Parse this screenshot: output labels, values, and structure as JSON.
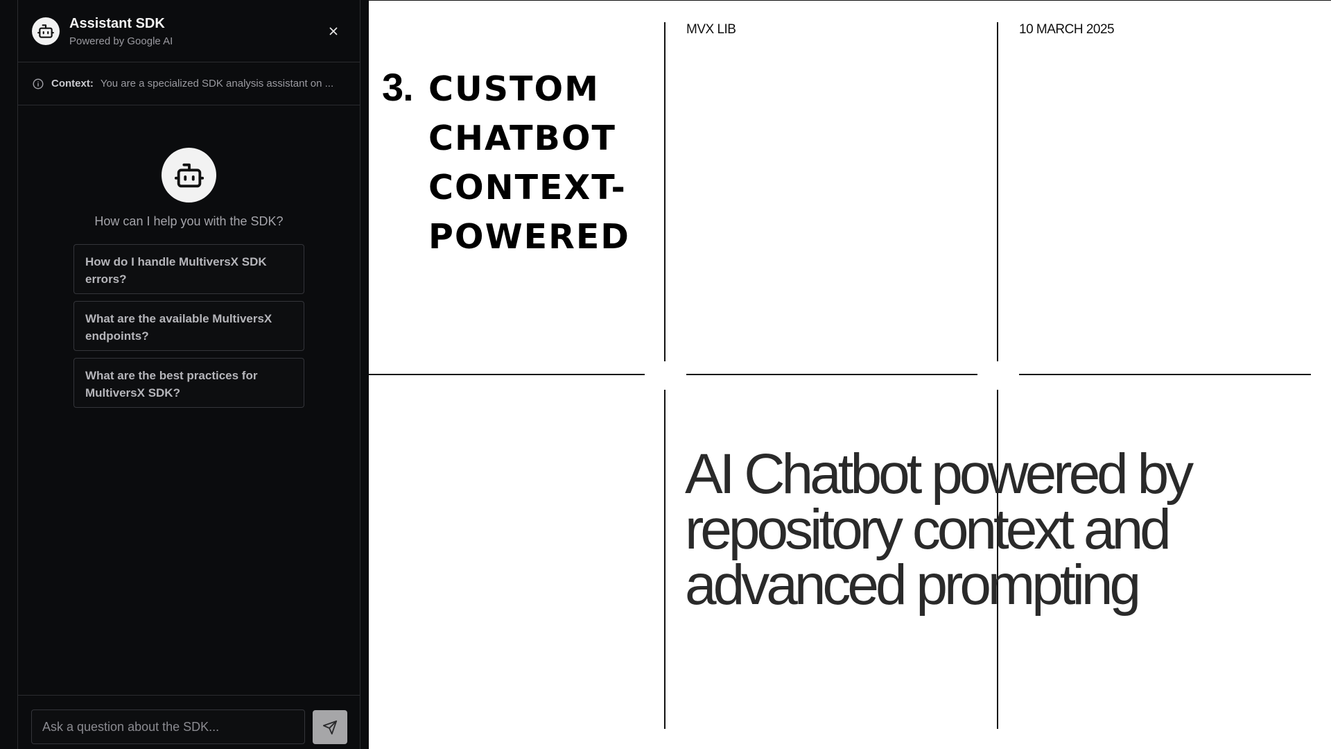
{
  "chat": {
    "title": "Assistant SDK",
    "subtitle": "Powered by Google AI",
    "context_label": "Context:",
    "context_text": "You are a specialized SDK analysis assistant on ...",
    "welcome": "How can I help you with the SDK?",
    "suggestions": [
      "How do I handle MultiversX SDK errors?",
      "What are the available MultiversX endpoints?",
      "What are the best practices for MultiversX SDK?"
    ],
    "input_placeholder": "Ask a question about the SDK...",
    "icons": {
      "header": "bot-icon",
      "close": "close-icon",
      "context": "info-icon",
      "welcome": "bot-icon",
      "send": "send-icon"
    }
  },
  "slide": {
    "section_number": "3.",
    "section_title": "CUSTOM CHATBOT CONTEXT-POWERED",
    "meta_left": "MVX LIB",
    "meta_right": "10 MARCH 2025",
    "headline": "AI Chatbot powered by repository context and advanced prompting"
  }
}
